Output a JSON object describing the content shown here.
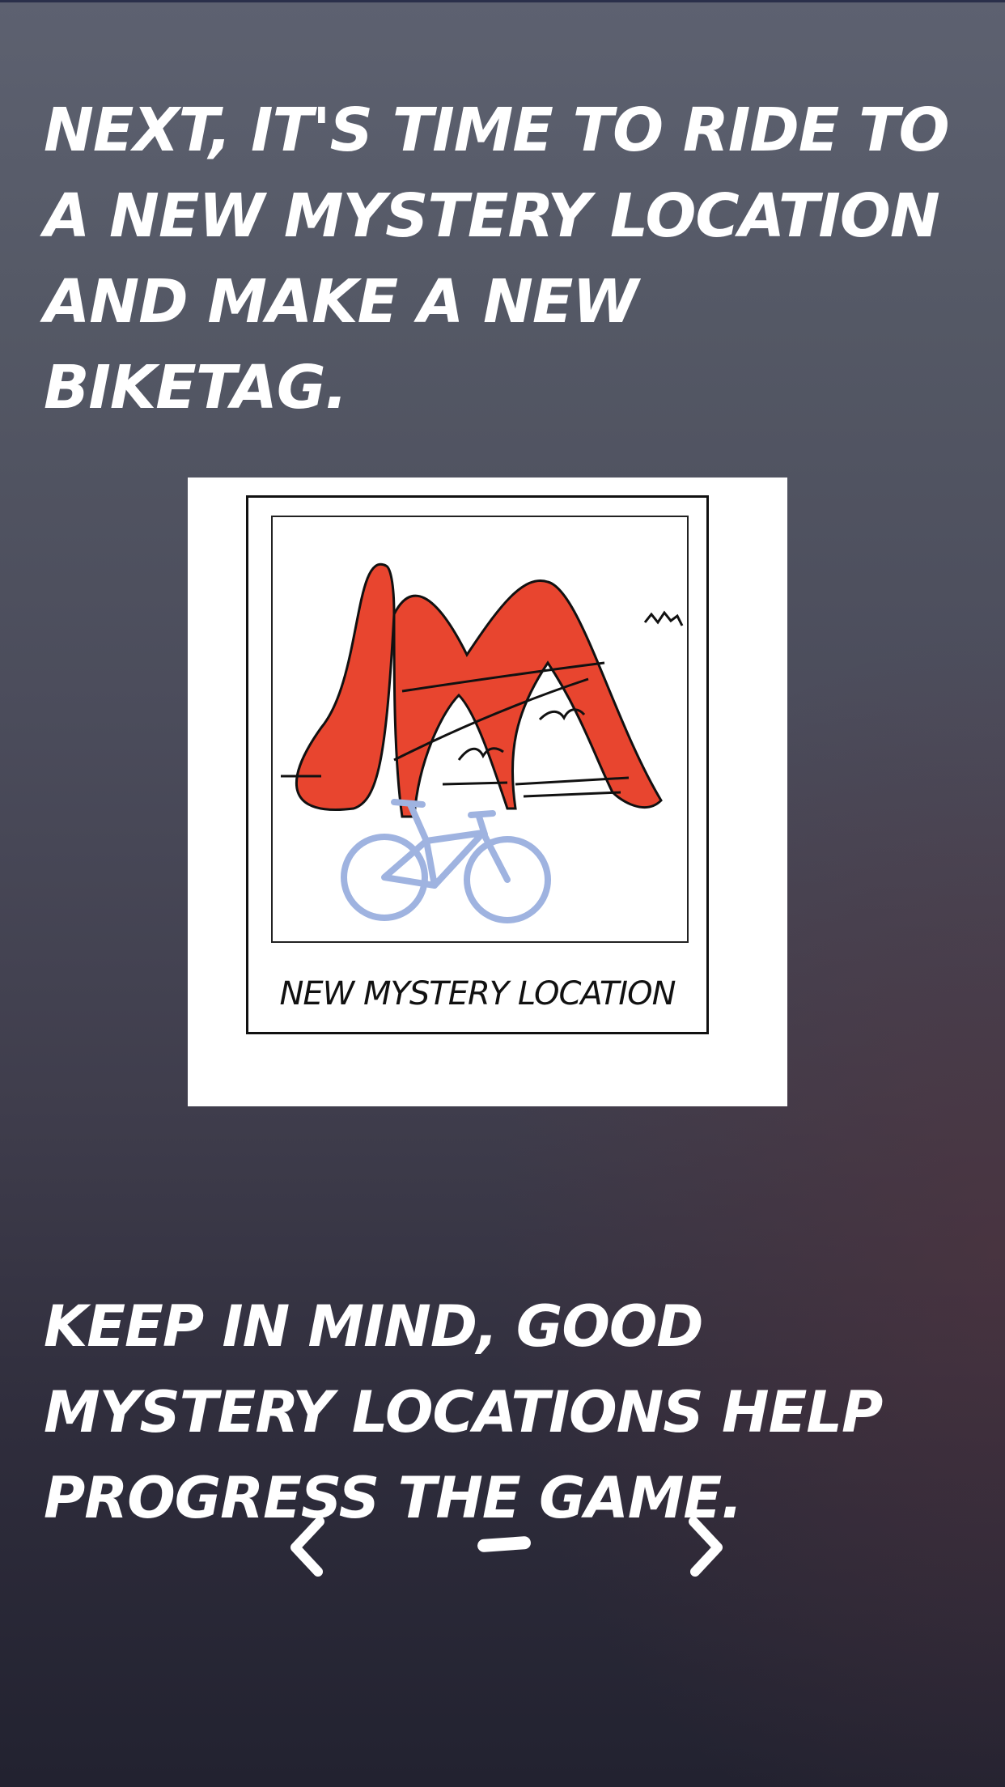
{
  "tutorial": {
    "intro_text": "Next, it's time to ride to a new mystery location and make a new BikeTag.",
    "illustration_caption": "New Mystery Location",
    "tip_text": "Keep in mind, good mystery locations help progress the game."
  },
  "illustration": {
    "icon": "sculpture-and-bicycle-illustration",
    "sculpture_color": "#e8452f",
    "bicycle_color": "#9fb3e0"
  },
  "pager": {
    "prev_icon": "chevron-left-icon",
    "next_icon": "chevron-right-icon",
    "indicator_icon": "dash-indicator"
  },
  "colors": {
    "text": "#ffffff",
    "card_background": "#ffffff"
  }
}
